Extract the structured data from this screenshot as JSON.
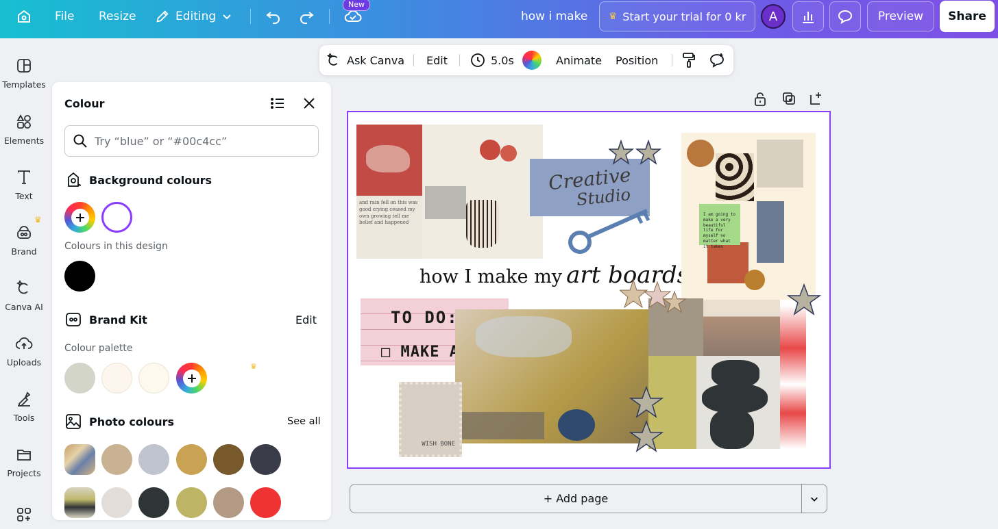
{
  "topbar": {
    "file_label": "File",
    "resize_label": "Resize",
    "editing_label": "Editing",
    "new_badge": "New",
    "design_title": "how i make",
    "trial_label": "Start your trial for 0 kr",
    "avatar_letter": "A",
    "preview_label": "Preview",
    "share_label": "Share"
  },
  "rail": {
    "items": [
      {
        "label": "Templates",
        "icon": "templates-icon"
      },
      {
        "label": "Elements",
        "icon": "elements-icon"
      },
      {
        "label": "Text",
        "icon": "text-icon"
      },
      {
        "label": "Brand",
        "icon": "brand-icon"
      },
      {
        "label": "Canva AI",
        "icon": "canva-ai-icon"
      },
      {
        "label": "Uploads",
        "icon": "uploads-icon"
      },
      {
        "label": "Tools",
        "icon": "tools-icon"
      },
      {
        "label": "Projects",
        "icon": "projects-icon"
      }
    ]
  },
  "panel": {
    "title": "Colour",
    "search_placeholder": "Try “blue” or “#00c4cc”",
    "background_heading": "Background colours",
    "in_design_label": "Colours in this design",
    "in_design_colors": [
      "#000000"
    ],
    "brand_heading": "Brand Kit",
    "brand_edit": "Edit",
    "palette_label": "Colour palette",
    "palette_colors": [
      "#d3d5c9",
      "#fdf6ee",
      "#fdf9ec"
    ],
    "photo_heading": "Photo colours",
    "see_all": "See all",
    "photo_row1": [
      "#c8b291",
      "#bfc4cf",
      "#c9a253",
      "#77592c",
      "#3a3b49"
    ],
    "photo_row2": [
      "#e2ddd8",
      "#2f3436",
      "#bdb466",
      "#b39a84",
      "#ef3333"
    ],
    "accent": "#8b3dff"
  },
  "canvas_toolbar": {
    "ask_label": "Ask Canva",
    "edit_label": "Edit",
    "duration": "5.0s",
    "animate_label": "Animate",
    "position_label": "Position"
  },
  "design": {
    "title_plain": "how I make my",
    "title_italic": "art boards",
    "logo_line1": "Creative",
    "logo_line2": "Studio",
    "todo_line1": "TO DO:",
    "todo_line2": "□ MAKE ART",
    "stamp_text": "WISH BONE",
    "postit_text": "I am going to make a very beautiful life for myself no matter what it takes"
  },
  "add_page_label": "+ Add page"
}
